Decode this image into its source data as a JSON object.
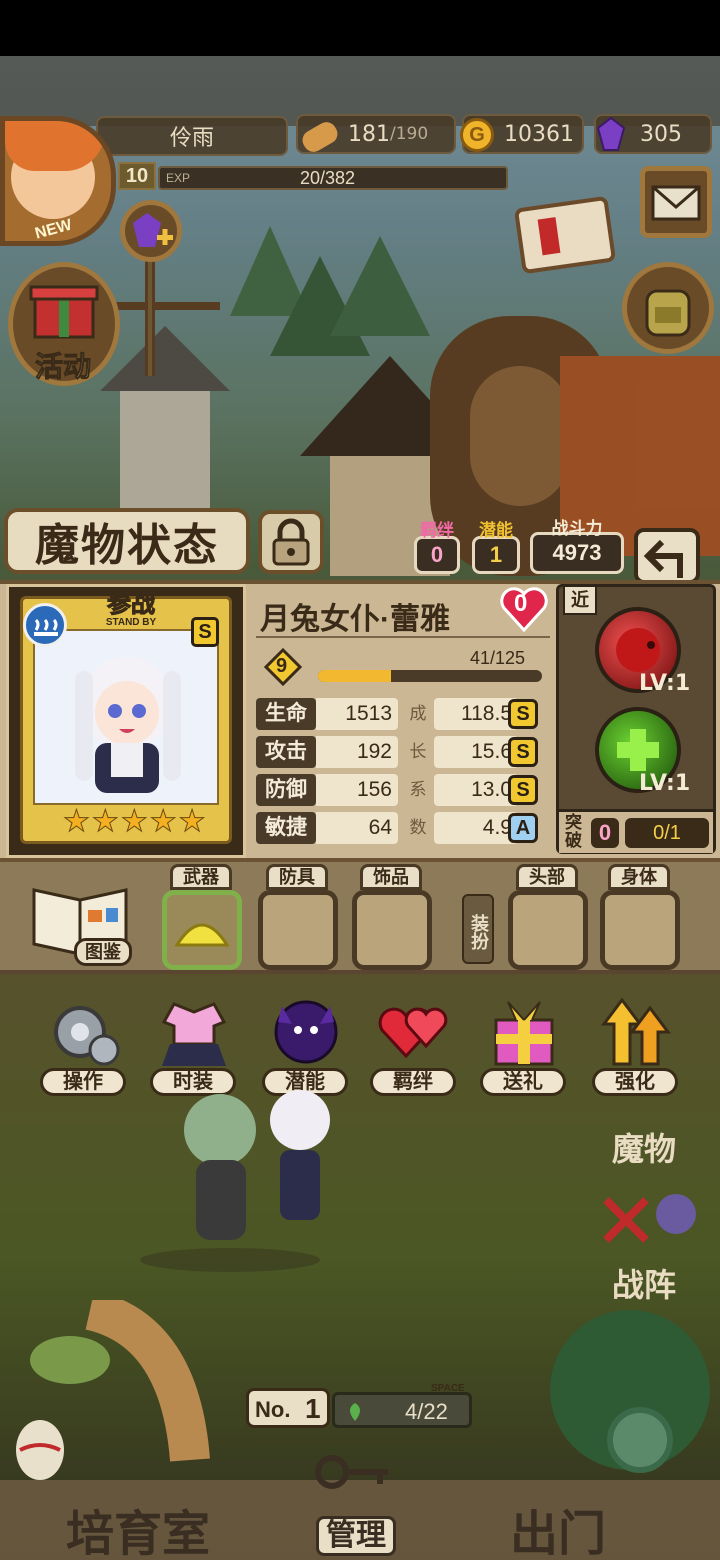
{
  "player": {
    "name": "伶雨",
    "level": "10",
    "exp_label": "EXP",
    "exp_text": "20/382",
    "exp_fraction": 0.052,
    "avatar_badge": "NEW"
  },
  "resources": {
    "stamina": "181",
    "stamina_max": "/190",
    "gold": "10361",
    "gems": "305"
  },
  "left_menu": {
    "activity_label": "活动"
  },
  "monster_status": {
    "title": "魔物状态",
    "bond": {
      "label": "羁绊",
      "value": "0"
    },
    "potential": {
      "label": "潜能",
      "value": "1"
    },
    "power": {
      "label": "战斗力",
      "value": "4973"
    }
  },
  "monster": {
    "name": "月兔女仆·蕾雅",
    "affection": "0",
    "standby_label": "参战",
    "standby_sub": "STAND BY",
    "card_rank": "S",
    "stars": 5,
    "level": "9",
    "exp_text": "41/125",
    "exp_fraction": 0.328,
    "growth_chars": [
      "成",
      "长",
      "系",
      "数"
    ],
    "stats": [
      {
        "label": "生命",
        "value": "1513",
        "growth": "118.5",
        "rank": "S"
      },
      {
        "label": "攻击",
        "value": "192",
        "growth": "15.6",
        "rank": "S"
      },
      {
        "label": "防御",
        "value": "156",
        "growth": "13.0",
        "rank": "S"
      },
      {
        "label": "敏捷",
        "value": "64",
        "growth": "4.9",
        "rank": "A"
      }
    ]
  },
  "skills": {
    "range_label": "近",
    "skill1_lv": "LV:1",
    "skill2_lv": "LV:1",
    "breakthrough_label": "突破",
    "breakthrough_value": "0",
    "breakthrough_progress": "0/1"
  },
  "equipment": {
    "codex_label": "图鉴",
    "slots": [
      "武器",
      "防具",
      "饰品"
    ],
    "dressup_label": "装扮",
    "costume_slots": [
      "头部",
      "身体"
    ]
  },
  "actions": [
    "操作",
    "时装",
    "潜能",
    "羁绊",
    "送礼",
    "强化"
  ],
  "side": {
    "monsters_label": "魔物",
    "formation_label": "战阵"
  },
  "pen": {
    "prefix": "No.",
    "number": "1",
    "space_label": "SPACE",
    "space_value": "4/22"
  },
  "bottom_nav": [
    "培育室",
    "管理",
    "出门"
  ],
  "colors": {
    "gold": "#f2c830",
    "panel": "#cbb793",
    "dark": "#3a2a18",
    "affection": "#e0264a"
  }
}
